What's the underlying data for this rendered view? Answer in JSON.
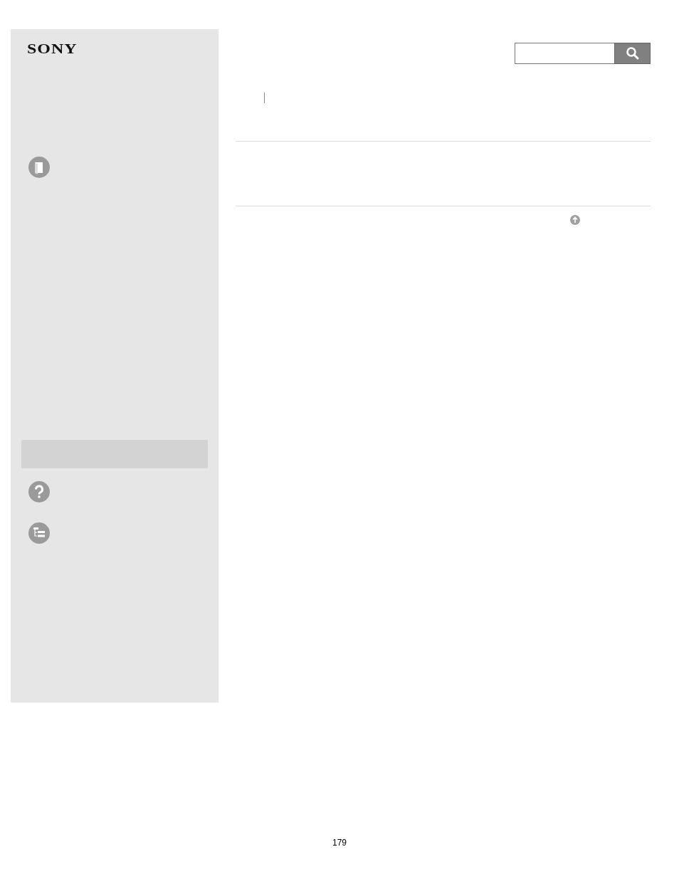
{
  "sidebar": {
    "logo": "SONY"
  },
  "footer": {
    "page_number": "179"
  }
}
